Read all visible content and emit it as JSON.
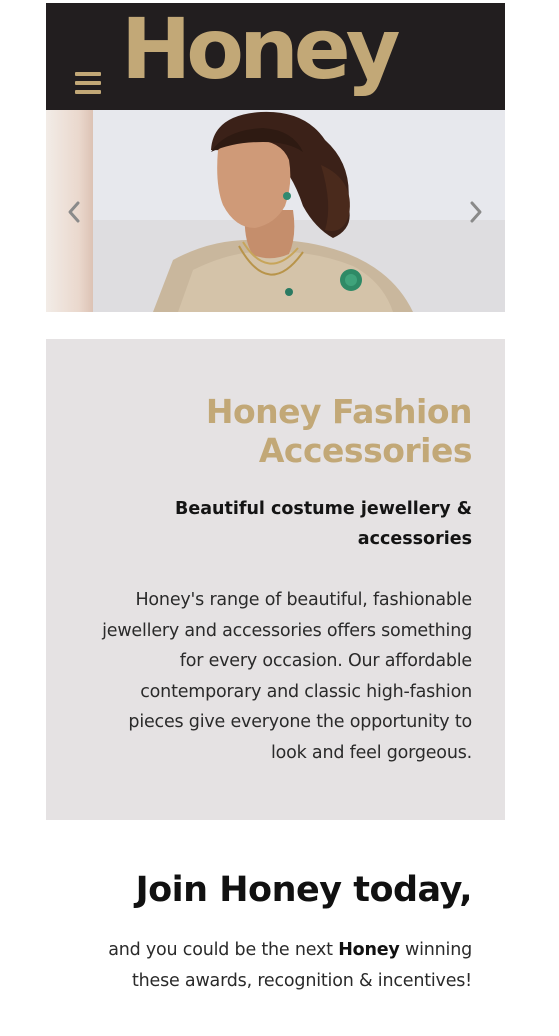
{
  "header": {
    "logo_text": "Honey",
    "menu_icon": "hamburger-menu-icon",
    "background_color": "#221e1f",
    "brand_color": "#c2a877"
  },
  "carousel": {
    "prev_icon": "chevron-left-icon",
    "next_icon": "chevron-right-icon"
  },
  "info": {
    "title_line1": "Honey Fashion",
    "title_line2": "Accessories",
    "subtitle_line1": "Beautiful costume jewellery &",
    "subtitle_line2": "accessories",
    "body_lines": [
      "Honey's range of beautiful, fashionable",
      "jewellery and accessories offers something",
      "for every occasion. Our affordable",
      "contemporary and classic high-fashion",
      "pieces give everyone the opportunity to",
      "look and feel gorgeous."
    ],
    "background_color": "#e5e2e3"
  },
  "join": {
    "title": "Join Honey today,",
    "text_before": "and you could be the next ",
    "text_brand": "Honey",
    "text_after": " winning",
    "text_line2": "these awards, recognition & incentives!"
  }
}
